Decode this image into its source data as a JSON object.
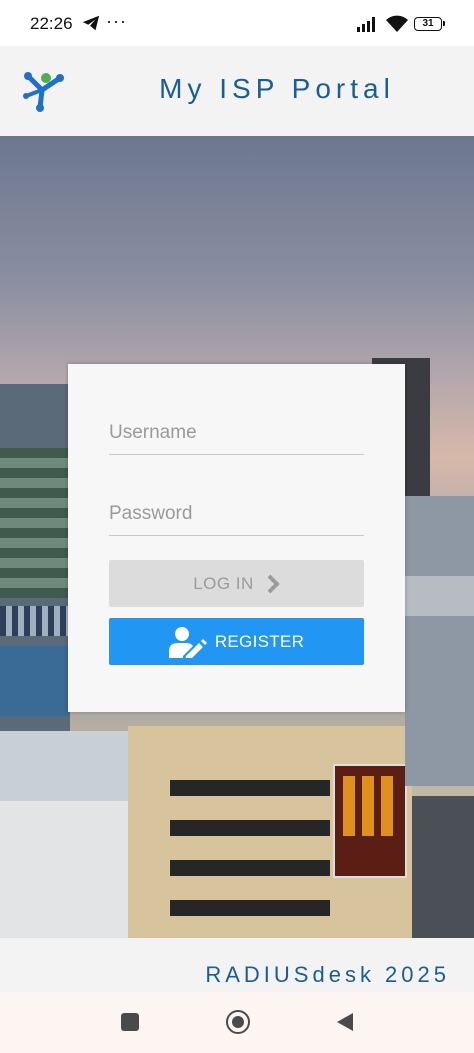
{
  "status_bar": {
    "time": "22:26",
    "more": "···",
    "battery": "31",
    "icons": [
      "telegram-icon",
      "signal-icon",
      "wifi-icon",
      "battery-icon"
    ]
  },
  "header": {
    "title": "My ISP Portal",
    "logo_icon": "network-nodes-logo"
  },
  "login": {
    "username_placeholder": "Username",
    "username_value": "",
    "password_placeholder": "Password",
    "password_value": "",
    "login_label": "LOG IN",
    "login_icon": "chevron-right-icon",
    "register_label": "REGISTER",
    "register_icon": "user-edit-icon"
  },
  "footer": {
    "text": "RADIUSdesk 2025"
  },
  "nav": {
    "icons": [
      "recents-square-icon",
      "home-circle-icon",
      "back-triangle-icon"
    ]
  },
  "colors": {
    "accent_blue": "#2196f3",
    "title_blue": "#1a5d95",
    "disabled_grey": "#dcdcdc"
  }
}
